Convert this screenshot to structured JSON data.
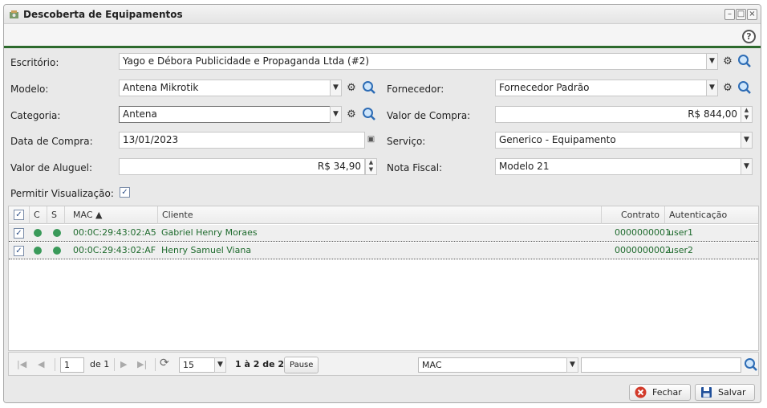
{
  "window": {
    "title": "Descoberta de Equipamentos",
    "controls": [
      "minimize-icon",
      "maximize-icon",
      "close-icon"
    ]
  },
  "toolbar": {
    "help_icon": "help-icon",
    "help_label": "?"
  },
  "form": {
    "escritorio": {
      "label": "Escritório:",
      "value": "Yago e Débora Publicidade e Propaganda Ltda (#2)"
    },
    "modelo": {
      "label": "Modelo:",
      "value": "Antena Mikrotik"
    },
    "fornecedor": {
      "label": "Fornecedor:",
      "value": "Fornecedor Padrão"
    },
    "categoria": {
      "label": "Categoria:",
      "value": "Antena"
    },
    "valor_compra": {
      "label": "Valor de Compra:",
      "value": "R$ 844,00"
    },
    "data_compra": {
      "label": "Data de Compra:",
      "value": "13/01/2023"
    },
    "servico": {
      "label": "Serviço:",
      "value": "Generico - Equipamento"
    },
    "valor_aluguel": {
      "label": "Valor de Aluguel:",
      "value": "R$ 34,90"
    },
    "nota_fiscal": {
      "label": "Nota Fiscal:",
      "value": "Modelo 21"
    },
    "permitir": {
      "label": "Permitir Visualização:",
      "checked": true
    }
  },
  "grid": {
    "headers": {
      "c": "C",
      "s": "S",
      "mac": "MAC ▲",
      "cliente": "Cliente",
      "contrato": "Contrato",
      "auth": "Autenticação Usuário"
    },
    "rows": [
      {
        "mac": "00:0C:29:43:02:A5",
        "cliente": "Gabriel Henry Moraes",
        "contrato": "0000000001",
        "auth": "user1",
        "checked": true,
        "c_status": "online",
        "s_status": "online"
      },
      {
        "mac": "00:0C:29:43:02:AF",
        "cliente": "Henry Samuel Viana",
        "contrato": "0000000002",
        "auth": "user2",
        "checked": true,
        "c_status": "online",
        "s_status": "online"
      }
    ],
    "status_color": "#3a9a5a"
  },
  "pager": {
    "page": "1",
    "of_label": "de 1",
    "page_size": "15",
    "summary": "1 à 2 de 2",
    "pause_label": "Pause",
    "search_field": "MAC",
    "search_value": ""
  },
  "footer": {
    "close_label": "Fechar",
    "save_label": "Salvar"
  },
  "colors": {
    "accent_green": "#2d6a2d",
    "link_green": "#1f6b2e"
  }
}
